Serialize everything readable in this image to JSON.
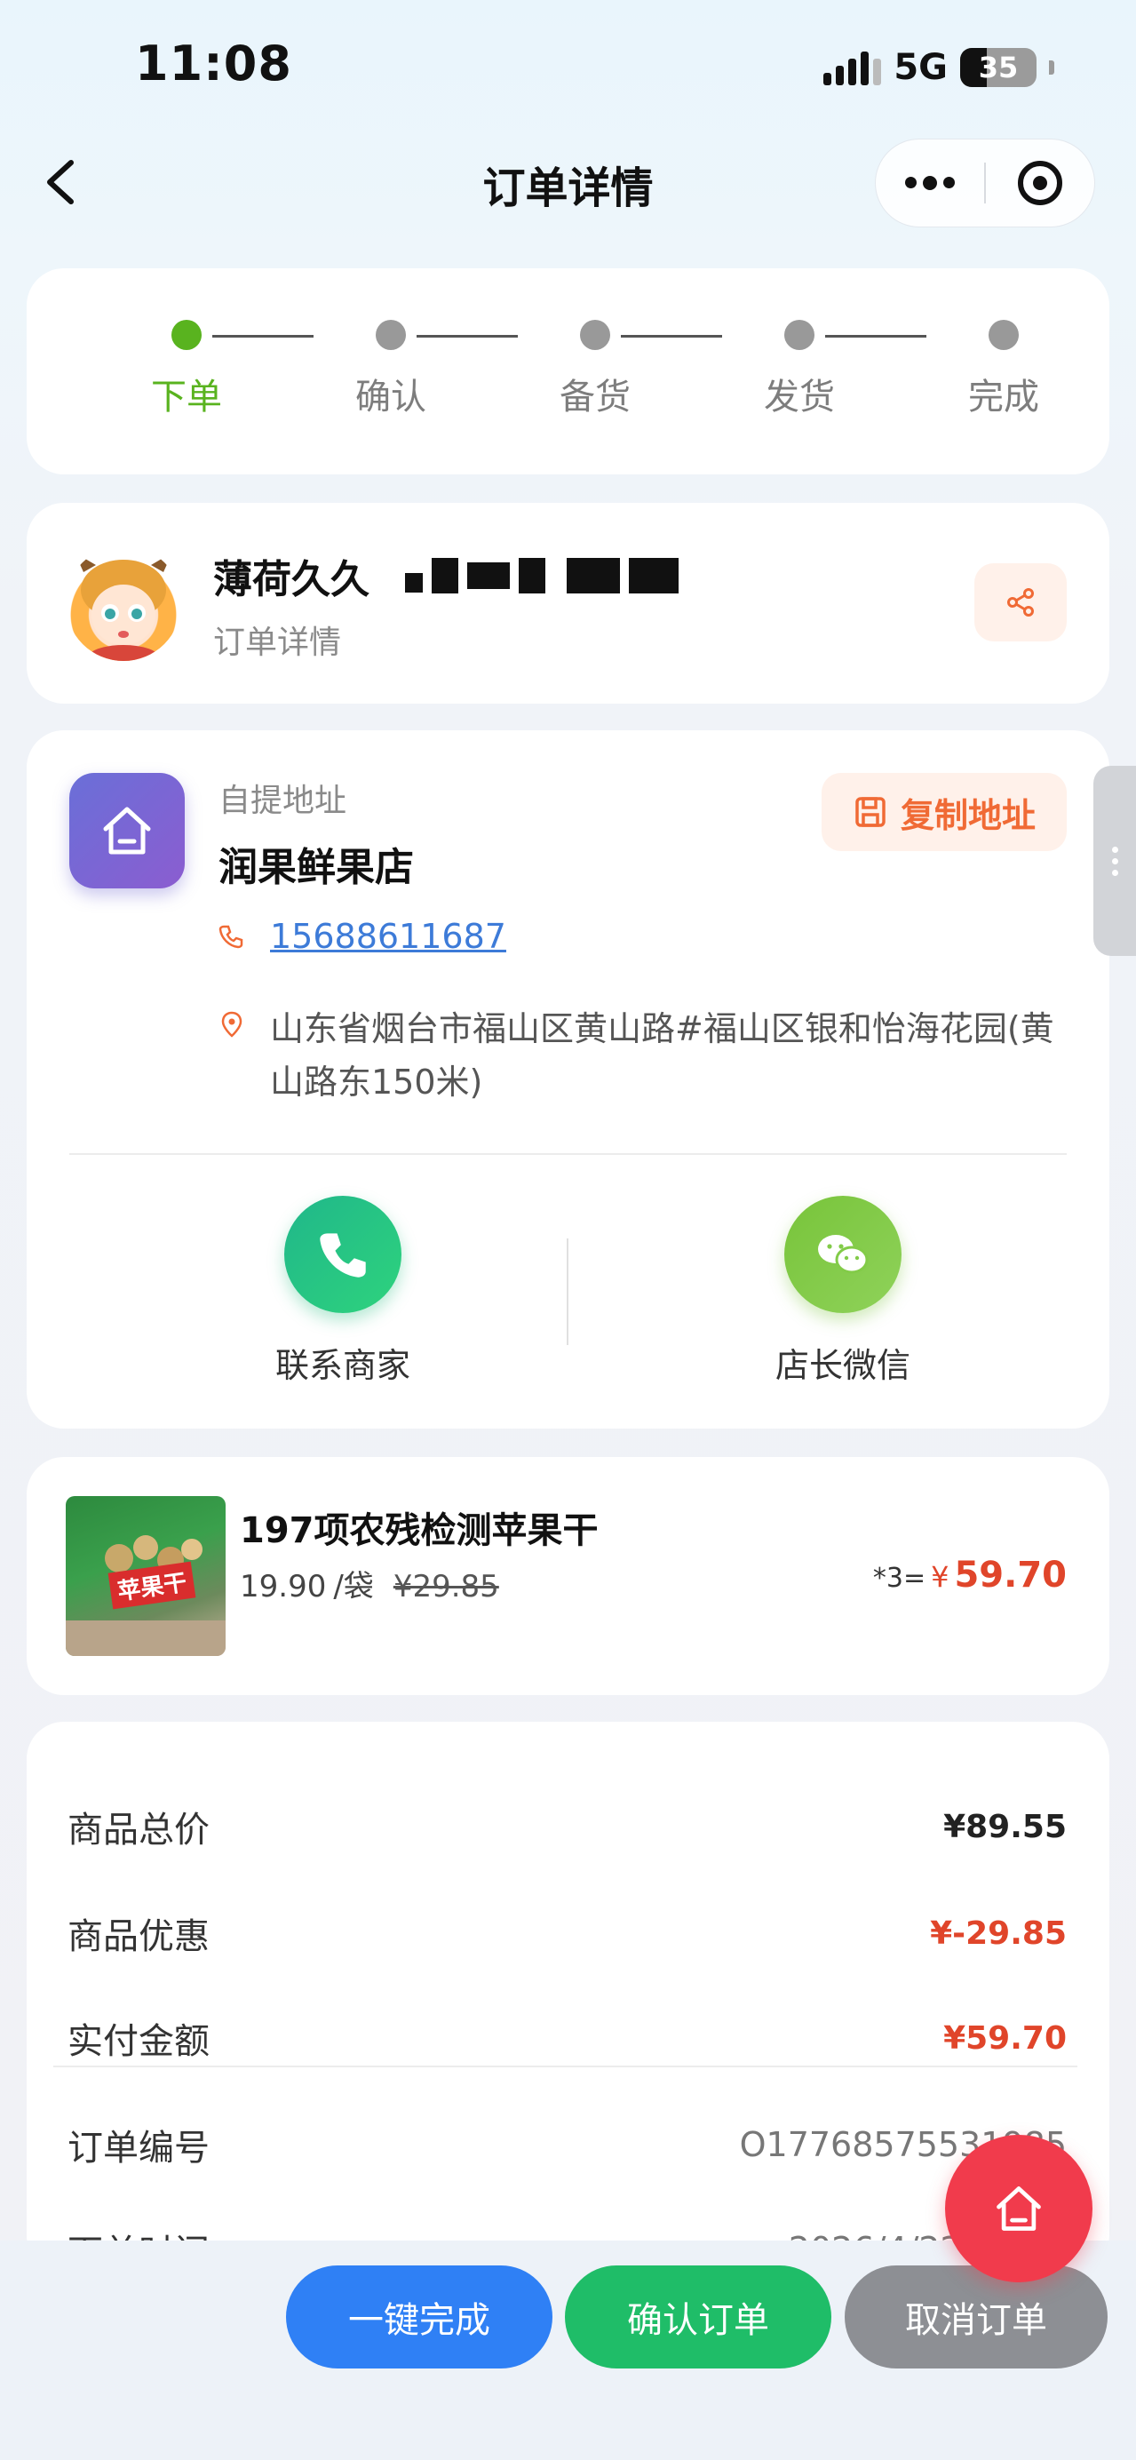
{
  "status_bar": {
    "time": "11:08",
    "network": "5G",
    "battery": "35",
    "battery_level": 0.35
  },
  "nav": {
    "title": "订单详情"
  },
  "progress": {
    "steps": [
      {
        "label": "下单",
        "active": true
      },
      {
        "label": "确认",
        "active": false
      },
      {
        "label": "备货",
        "active": false
      },
      {
        "label": "发货",
        "active": false
      },
      {
        "label": "完成",
        "active": false
      }
    ]
  },
  "user": {
    "name": "薄荷久久",
    "subtitle": "订单详情"
  },
  "pickup": {
    "label": "自提地址",
    "store_name": "润果鲜果店",
    "copy_button": "复制地址",
    "phone": "15688611687",
    "address": "山东省烟台市福山区黄山路#福山区银和怡海花园(黄山路东150米)"
  },
  "contacts": {
    "merchant": "联系商家",
    "wechat": "店长微信"
  },
  "product": {
    "name": "197项农残检测苹果干",
    "price": "19.90",
    "unit": "/袋",
    "original_price": "¥29.85",
    "multiplier": "*3=",
    "currency": "¥",
    "total": "59.70",
    "image_tag": "苹果干"
  },
  "summary": {
    "goods_total_label": "商品总价",
    "goods_total": "¥89.55",
    "discount_label": "商品优惠",
    "discount": "¥-29.85",
    "paid_label": "实付金额",
    "paid": "¥59.70",
    "order_no_label": "订单编号",
    "order_no": "O17768575531985",
    "order_time_label": "下单时间",
    "order_time": "2026/4/22 1"
  },
  "actions": {
    "complete": "一键完成",
    "confirm": "确认订单",
    "cancel": "取消订单"
  },
  "colors": {
    "green": "#59b31f",
    "orange": "#f06a35",
    "red": "#e0452a",
    "blue": "#2f80f5",
    "button_green": "#1fbd68",
    "grey": "#8d8f94"
  }
}
